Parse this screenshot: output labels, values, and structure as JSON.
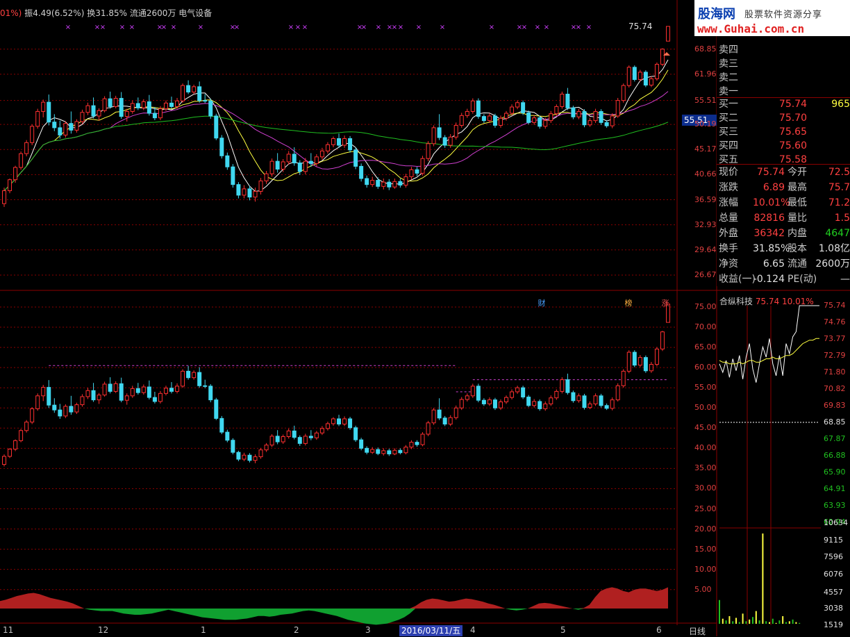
{
  "header": {
    "prefix": "01%)",
    "amplitude": "振4.49(6.52%)",
    "turnover": "换31.85%",
    "float": "流通2600万",
    "sector": "电气设备"
  },
  "logo": {
    "cn_name": "股海网",
    "slogan": "股票软件资源分享",
    "url": "www.Guhai.com.cn"
  },
  "cursor_price": "75.74",
  "current_price_box": "55.51",
  "main_axis_labels": [
    "68.85",
    "61.96",
    "55.51",
    "50.19",
    "45.17",
    "40.66",
    "36.59",
    "32.93",
    "29.64",
    "26.67"
  ],
  "sub_axis_labels": [
    "75.00",
    "70.00",
    "65.00",
    "60.00",
    "55.00",
    "50.00",
    "45.00",
    "40.00",
    "35.00",
    "30.00",
    "25.00",
    "20.00",
    "15.00",
    "10.00",
    "5.00"
  ],
  "orderbook": {
    "sell": [
      {
        "label": "卖四",
        "price": "",
        "vol": ""
      },
      {
        "label": "卖三",
        "price": "",
        "vol": ""
      },
      {
        "label": "卖二",
        "price": "",
        "vol": ""
      },
      {
        "label": "卖一",
        "price": "",
        "vol": ""
      }
    ],
    "buy": [
      {
        "label": "买一",
        "price": "75.74",
        "vol": "965"
      },
      {
        "label": "买二",
        "price": "75.70",
        "vol": ""
      },
      {
        "label": "买三",
        "price": "75.65",
        "vol": ""
      },
      {
        "label": "买四",
        "price": "75.60",
        "vol": ""
      },
      {
        "label": "买五",
        "price": "75.58",
        "vol": ""
      }
    ]
  },
  "stats": [
    {
      "l1": "现价",
      "v1": "75.74",
      "l2": "今开",
      "v2": "72.5"
    },
    {
      "l1": "涨跌",
      "v1": "6.89",
      "l2": "最高",
      "v2": "75.7"
    },
    {
      "l1": "涨幅",
      "v1": "10.01%",
      "l2": "最低",
      "v2": "71.2"
    },
    {
      "l1": "总量",
      "v1": "82816",
      "l2": "量比",
      "v2": "1.5"
    },
    {
      "l1": "外盘",
      "v1": "36342",
      "l2": "内盘",
      "v2": "4647"
    },
    {
      "l1": "换手",
      "v1": "31.85%",
      "l2": "股本",
      "v2": "1.08亿"
    },
    {
      "l1": "净资",
      "v1": "6.65",
      "l2": "流通",
      "v2": "2600万"
    },
    {
      "l1": "收益(一)",
      "v1": "-0.124",
      "l2": "PE(动)",
      "v2": "—"
    }
  ],
  "mini_chart": {
    "title": "合纵科技",
    "price": "75.74",
    "pct": "10.01%",
    "price_axis": [
      "75.74",
      "74.76",
      "73.77",
      "72.79",
      "71.80",
      "70.82",
      "69.83",
      "68.85",
      "67.87",
      "66.88",
      "65.90",
      "64.91",
      "63.93",
      "62.94"
    ],
    "vol_axis": [
      "10634",
      "9115",
      "7596",
      "6076",
      "4557",
      "3038",
      "1519"
    ]
  },
  "tags": [
    "财",
    "榜",
    "涨"
  ],
  "x_axis": [
    "11",
    "12",
    "1",
    "2",
    "3",
    "4",
    "5",
    "6"
  ],
  "date_box": "2016/03/11/五",
  "period_label": "日线",
  "colors": {
    "up": "#ff3030",
    "down": "#40d8f0",
    "ma5": "#ffffff",
    "ma10": "#ffff40",
    "ma20": "#d040d0",
    "ma60": "#20c020",
    "grid": "#8b0000"
  },
  "chart_data": {
    "type": "candlestick",
    "title": "合纵科技",
    "ylim_main": [
      26.67,
      75.74
    ],
    "ylim_sub": [
      5,
      75
    ],
    "candles": [
      [
        36.0,
        38.5,
        35.5,
        38.0
      ],
      [
        38.0,
        40.0,
        37.6,
        39.8
      ],
      [
        39.8,
        42.2,
        39.3,
        41.9
      ],
      [
        41.9,
        44.8,
        41.5,
        44.4
      ],
      [
        44.4,
        47.0,
        43.9,
        46.5
      ],
      [
        46.5,
        50.2,
        46.0,
        49.8
      ],
      [
        49.8,
        53.6,
        49.3,
        53.0
      ],
      [
        53.0,
        55.7,
        51.7,
        55.1
      ],
      [
        55.1,
        56.9,
        50.0,
        50.7
      ],
      [
        50.7,
        52.4,
        48.8,
        49.5
      ],
      [
        49.5,
        51.0,
        47.3,
        48.0
      ],
      [
        48.0,
        50.9,
        47.5,
        50.4
      ],
      [
        50.4,
        53.0,
        48.3,
        49.0
      ],
      [
        49.0,
        51.3,
        48.5,
        50.8
      ],
      [
        50.8,
        53.4,
        50.3,
        52.8
      ],
      [
        52.8,
        55.0,
        52.2,
        54.3
      ],
      [
        54.3,
        56.2,
        51.5,
        52.0
      ],
      [
        52.0,
        53.7,
        51.0,
        53.2
      ],
      [
        53.2,
        56.5,
        52.8,
        55.9
      ],
      [
        55.9,
        57.6,
        53.6,
        54.1
      ],
      [
        54.1,
        56.6,
        53.7,
        56.0
      ],
      [
        56.0,
        57.5,
        51.4,
        51.9
      ],
      [
        51.9,
        53.6,
        50.8,
        53.0
      ],
      [
        53.0,
        55.5,
        52.5,
        54.8
      ],
      [
        54.8,
        56.2,
        53.3,
        53.8
      ],
      [
        53.8,
        55.8,
        53.3,
        55.2
      ],
      [
        55.2,
        56.8,
        52.1,
        52.6
      ],
      [
        52.6,
        54.0,
        51.1,
        51.6
      ],
      [
        51.6,
        54.2,
        51.1,
        53.6
      ],
      [
        53.6,
        55.5,
        53.1,
        54.9
      ],
      [
        54.9,
        56.4,
        53.6,
        54.1
      ],
      [
        54.1,
        56.1,
        53.6,
        55.4
      ],
      [
        55.4,
        59.6,
        55.0,
        59.1
      ],
      [
        59.1,
        60.4,
        57.0,
        57.5
      ],
      [
        57.5,
        59.3,
        57.0,
        58.8
      ],
      [
        58.8,
        60.1,
        55.0,
        55.5
      ],
      [
        55.5,
        57.0,
        54.9,
        55.4
      ],
      [
        55.4,
        55.9,
        51.4,
        52.0
      ],
      [
        52.0,
        52.5,
        47.0,
        47.4
      ],
      [
        47.4,
        48.0,
        43.5,
        44.0
      ],
      [
        44.0,
        44.6,
        41.5,
        42.0
      ],
      [
        42.0,
        42.5,
        38.5,
        39.0
      ],
      [
        39.0,
        39.4,
        36.8,
        37.3
      ],
      [
        37.3,
        38.9,
        36.8,
        38.3
      ],
      [
        38.3,
        38.8,
        36.5,
        37.0
      ],
      [
        37.0,
        38.5,
        36.3,
        37.9
      ],
      [
        37.9,
        40.1,
        37.4,
        39.6
      ],
      [
        39.6,
        41.3,
        39.1,
        40.8
      ],
      [
        40.8,
        43.5,
        40.3,
        43.0
      ],
      [
        43.0,
        44.5,
        41.0,
        41.6
      ],
      [
        41.6,
        43.4,
        41.1,
        42.9
      ],
      [
        42.9,
        44.9,
        42.4,
        44.3
      ],
      [
        44.3,
        45.6,
        42.2,
        42.7
      ],
      [
        42.7,
        43.2,
        40.6,
        41.2
      ],
      [
        41.2,
        43.6,
        40.7,
        43.0
      ],
      [
        43.0,
        44.5,
        42.0,
        42.6
      ],
      [
        42.6,
        44.3,
        42.1,
        43.8
      ],
      [
        43.8,
        45.5,
        43.3,
        44.9
      ],
      [
        44.9,
        46.6,
        44.4,
        46.1
      ],
      [
        46.1,
        47.7,
        45.6,
        47.3
      ],
      [
        47.3,
        48.3,
        45.5,
        46.0
      ],
      [
        46.0,
        47.9,
        45.5,
        47.3
      ],
      [
        47.3,
        47.8,
        44.6,
        45.1
      ],
      [
        45.1,
        45.6,
        41.6,
        42.1
      ],
      [
        42.1,
        42.6,
        39.5,
        40.0
      ],
      [
        40.0,
        40.5,
        38.5,
        39.0
      ],
      [
        39.0,
        40.3,
        38.6,
        39.7
      ],
      [
        39.7,
        40.2,
        38.3,
        38.7
      ],
      [
        38.7,
        40.0,
        38.2,
        39.4
      ],
      [
        39.4,
        39.9,
        38.1,
        38.6
      ],
      [
        38.6,
        40.0,
        38.3,
        39.5
      ],
      [
        39.5,
        40.0,
        38.5,
        38.9
      ],
      [
        38.9,
        40.8,
        38.5,
        40.3
      ],
      [
        40.3,
        42.0,
        39.8,
        41.5
      ],
      [
        41.5,
        42.0,
        40.4,
        40.9
      ],
      [
        40.9,
        44.0,
        40.5,
        43.5
      ],
      [
        43.5,
        46.8,
        43.0,
        46.3
      ],
      [
        46.3,
        50.0,
        45.8,
        49.5
      ],
      [
        49.5,
        52.4,
        47.0,
        47.5
      ],
      [
        47.5,
        48.0,
        45.5,
        46.0
      ],
      [
        46.0,
        48.2,
        45.5,
        47.6
      ],
      [
        47.6,
        50.6,
        47.1,
        50.0
      ],
      [
        50.0,
        52.7,
        49.5,
        52.1
      ],
      [
        52.1,
        53.6,
        51.6,
        53.0
      ],
      [
        53.0,
        56.0,
        52.5,
        55.4
      ],
      [
        55.4,
        56.0,
        51.4,
        51.9
      ],
      [
        51.9,
        52.4,
        50.5,
        51.0
      ],
      [
        51.0,
        52.6,
        50.5,
        52.0
      ],
      [
        52.0,
        52.5,
        49.5,
        50.0
      ],
      [
        50.0,
        52.1,
        49.5,
        51.5
      ],
      [
        51.5,
        53.1,
        51.0,
        52.6
      ],
      [
        52.6,
        54.6,
        52.1,
        54.0
      ],
      [
        54.0,
        55.5,
        53.5,
        55.0
      ],
      [
        55.0,
        55.5,
        52.2,
        52.7
      ],
      [
        52.7,
        53.2,
        50.2,
        50.6
      ],
      [
        50.6,
        52.2,
        50.1,
        51.6
      ],
      [
        51.6,
        52.1,
        49.3,
        49.8
      ],
      [
        49.8,
        51.6,
        49.3,
        51.0
      ],
      [
        51.0,
        53.1,
        50.5,
        52.5
      ],
      [
        52.5,
        54.6,
        52.0,
        54.1
      ],
      [
        54.1,
        57.6,
        53.6,
        57.0
      ],
      [
        57.0,
        58.5,
        53.3,
        53.8
      ],
      [
        53.8,
        54.3,
        51.3,
        51.8
      ],
      [
        51.8,
        53.6,
        51.3,
        53.0
      ],
      [
        53.0,
        53.5,
        49.6,
        50.1
      ],
      [
        50.1,
        51.6,
        49.7,
        51.0
      ],
      [
        51.0,
        53.6,
        50.5,
        53.0
      ],
      [
        53.0,
        53.5,
        50.1,
        50.6
      ],
      [
        50.6,
        51.1,
        49.5,
        49.9
      ],
      [
        49.9,
        52.6,
        49.4,
        52.0
      ],
      [
        52.0,
        56.1,
        51.6,
        55.5
      ],
      [
        55.5,
        59.6,
        55.0,
        59.1
      ],
      [
        59.1,
        64.3,
        58.6,
        63.8
      ],
      [
        63.8,
        64.3,
        60.1,
        60.6
      ],
      [
        60.6,
        63.1,
        60.1,
        62.5
      ],
      [
        62.5,
        63.0,
        58.7,
        59.2
      ],
      [
        59.2,
        61.4,
        58.7,
        60.8
      ],
      [
        60.8,
        65.1,
        60.3,
        64.6
      ],
      [
        64.6,
        69.1,
        64.1,
        68.85
      ],
      [
        71.2,
        75.74,
        71.2,
        75.74
      ]
    ],
    "ma_periods": [
      5,
      10,
      20,
      60
    ],
    "hist": [
      0.6,
      0.7,
      0.85,
      1.0,
      1.1,
      1.2,
      1.25,
      1.15,
      1.0,
      0.85,
      0.75,
      0.65,
      0.55,
      0.4,
      0.2,
      0.0,
      -0.1,
      -0.15,
      -0.2,
      -0.2,
      -0.2,
      -0.3,
      -0.4,
      -0.45,
      -0.5,
      -0.5,
      -0.45,
      -0.4,
      -0.3,
      -0.2,
      -0.1,
      -0.2,
      -0.3,
      -0.4,
      -0.5,
      -0.6,
      -0.7,
      -0.75,
      -0.8,
      -0.85,
      -0.9,
      -0.9,
      -0.9,
      -0.85,
      -0.8,
      -0.7,
      -0.6,
      -0.6,
      -0.65,
      -0.6,
      -0.5,
      -0.45,
      -0.4,
      -0.3,
      -0.2,
      -0.15,
      -0.2,
      -0.3,
      -0.4,
      -0.5,
      -0.6,
      -0.75,
      -0.9,
      -1.0,
      -1.1,
      -1.2,
      -1.25,
      -1.3,
      -1.25,
      -1.2,
      -1.05,
      -0.9,
      -0.7,
      -0.4,
      0.2,
      0.5,
      0.7,
      0.8,
      0.75,
      0.65,
      0.55,
      0.6,
      0.7,
      0.8,
      0.75,
      0.65,
      0.55,
      0.4,
      0.3,
      0.15,
      0.0,
      -0.1,
      -0.15,
      -0.1,
      0.0,
      0.2,
      0.4,
      0.45,
      0.4,
      0.3,
      0.2,
      0.1,
      0.0,
      -0.1,
      0.05,
      0.3,
      0.9,
      1.4,
      1.6,
      1.7,
      1.6,
      1.4,
      1.3,
      1.5,
      1.6,
      1.6,
      1.5,
      1.4,
      1.5,
      1.7
    ],
    "resistance_line": [
      {
        "from": 11,
        "to": 118,
        "value": 60.5
      },
      {
        "from": 118,
        "to": 123,
        "value": 54.0
      },
      {
        "from": 123,
        "to": 175,
        "value": 57.0
      }
    ],
    "intraday": {
      "prices": [
        72.3,
        71.8,
        72.5,
        71.5,
        72.6,
        71.9,
        72.8,
        71.4,
        72.7,
        73.5,
        72.0,
        71.2,
        72.3,
        73.3,
        72.7,
        73.8,
        72.3,
        71.6,
        72.8,
        71.6,
        73.5,
        72.9,
        73.9,
        74.2,
        75.74,
        75.74,
        75.74,
        75.74,
        75.74,
        75.74,
        75.74
      ],
      "avg": [
        72.5,
        72.4,
        72.4,
        72.3,
        72.3,
        72.3,
        72.4,
        72.3,
        72.4,
        72.5,
        72.5,
        72.4,
        72.4,
        72.5,
        72.6,
        72.6,
        72.7,
        72.6,
        72.6,
        72.7,
        72.8,
        72.8,
        72.9,
        73.1,
        73.3,
        73.5,
        73.6,
        73.7,
        73.7,
        73.8,
        73.8
      ],
      "volumes": [
        2800,
        600,
        400,
        900,
        300,
        700,
        200,
        1200,
        300,
        500,
        800,
        1500,
        400,
        10634,
        300,
        200,
        600,
        100,
        400,
        900,
        200,
        300,
        500,
        200,
        100,
        0,
        0,
        0,
        0,
        0,
        0
      ]
    }
  }
}
